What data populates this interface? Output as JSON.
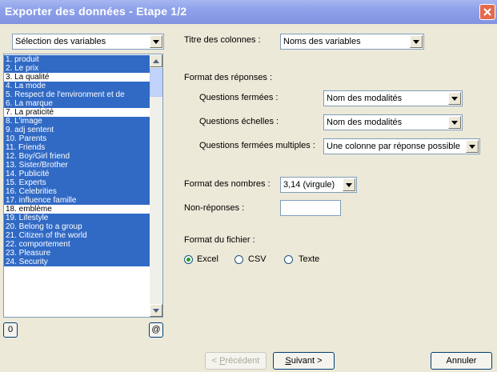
{
  "window": {
    "title": "Exporter des données - Etape 1/2"
  },
  "variables": {
    "selector_value": "Sélection des variables",
    "items": [
      {
        "label": "1. produit",
        "selected": true
      },
      {
        "label": "2. Le prix",
        "selected": true
      },
      {
        "label": "3. La qualité",
        "selected": false
      },
      {
        "label": "4. La mode",
        "selected": true
      },
      {
        "label": "5. Respect de l'environment et de",
        "selected": true
      },
      {
        "label": "6. La marque",
        "selected": true
      },
      {
        "label": "7. La praticité",
        "selected": false
      },
      {
        "label": "8. L'image",
        "selected": true
      },
      {
        "label": "9. adj sentent",
        "selected": true
      },
      {
        "label": "10. Parents",
        "selected": true
      },
      {
        "label": "11. Friends",
        "selected": true
      },
      {
        "label": "12. Boy/Girl friend",
        "selected": true
      },
      {
        "label": "13. Sister/Brother",
        "selected": true
      },
      {
        "label": "14. Publicité",
        "selected": true
      },
      {
        "label": "15. Experts",
        "selected": true
      },
      {
        "label": "16. Celebrities",
        "selected": true
      },
      {
        "label": "17. influence famille",
        "selected": true
      },
      {
        "label": "18. emblème",
        "selected": false
      },
      {
        "label": "19. Lifestyle",
        "selected": true
      },
      {
        "label": "20. Belong to a group",
        "selected": true
      },
      {
        "label": "21. Citizen of the world",
        "selected": true
      },
      {
        "label": "22. comportement",
        "selected": true
      },
      {
        "label": "23. Pleasure",
        "selected": true
      },
      {
        "label": "24. Security",
        "selected": true
      }
    ],
    "btn_zero": "0",
    "btn_at": "@"
  },
  "columns": {
    "label": "Titre des colonnes :",
    "value": "Noms des variables"
  },
  "responses": {
    "heading": "Format des réponses :",
    "closed_label": "Questions fermées :",
    "closed_value": "Nom des modalités",
    "scale_label": "Questions échelles :",
    "scale_value": "Nom des modalités",
    "multi_label": "Questions fermées multiples :",
    "multi_value": "Une colonne par réponse possible"
  },
  "numbers": {
    "label": "Format des nombres :",
    "value": "3,14 (virgule)"
  },
  "nonresponse": {
    "label": "Non-réponses :",
    "value": ""
  },
  "file_format": {
    "label": "Format du fichier :",
    "options": [
      {
        "label": "Excel",
        "checked": true
      },
      {
        "label": "CSV",
        "checked": false
      },
      {
        "label": "Texte",
        "checked": false
      }
    ]
  },
  "footer": {
    "prev_prefix": "< ",
    "prev_mnemonic": "P",
    "prev_rest": "récédent",
    "next_mnemonic": "S",
    "next_rest": "uivant >",
    "cancel": "Annuler"
  },
  "colors": {
    "selection": "#316ac5",
    "face": "#ece9d8",
    "title_bar": "#8ea1ea"
  }
}
